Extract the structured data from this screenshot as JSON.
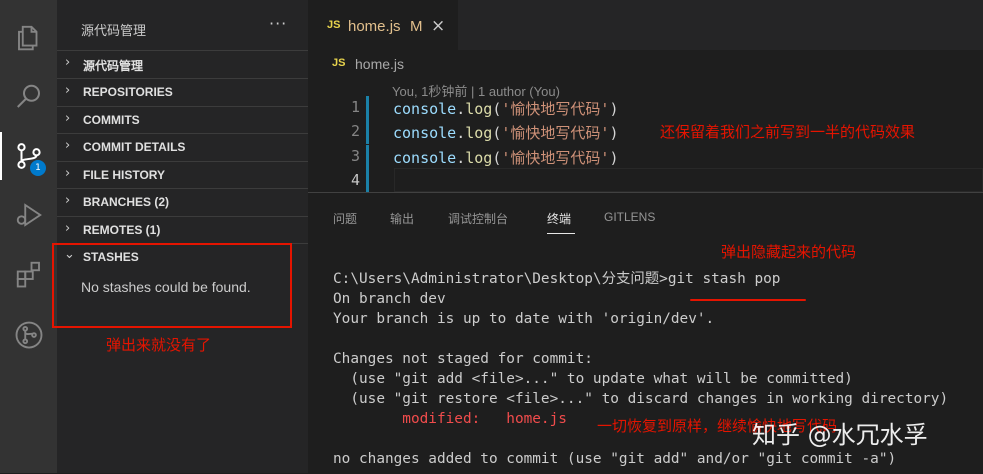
{
  "activity_bar": {
    "source_control_badge": "1"
  },
  "sidebar": {
    "title": "源代码管理",
    "more": "···",
    "sections": [
      {
        "label": "源代码管理",
        "state": "collapsed"
      },
      {
        "label": "REPOSITORIES",
        "state": "collapsed"
      },
      {
        "label": "COMMITS",
        "state": "collapsed"
      },
      {
        "label": "COMMIT DETAILS",
        "state": "collapsed"
      },
      {
        "label": "FILE HISTORY",
        "state": "collapsed"
      },
      {
        "label": "BRANCHES (2)",
        "state": "collapsed"
      },
      {
        "label": "REMOTES (1)",
        "state": "collapsed"
      },
      {
        "label": "STASHES",
        "state": "expanded"
      }
    ],
    "stashes_empty": "No stashes could be found.",
    "annotation": "弹出来就没有了"
  },
  "editor": {
    "tab": {
      "badge": "JS",
      "name": "home.js",
      "modified": "M",
      "close": "×"
    },
    "breadcrumb": {
      "badge": "JS",
      "file": "home.js"
    },
    "blame": "You, 1秒钟前 | 1 author (You)",
    "lines": [
      {
        "n": "1",
        "obj": "console",
        "fn": "log",
        "str": "'愉快地写代码'"
      },
      {
        "n": "2",
        "obj": "console",
        "fn": "log",
        "str": "'愉快地写代码'"
      },
      {
        "n": "3",
        "obj": "console",
        "fn": "log",
        "str": "'愉快地写代码'"
      },
      {
        "n": "4",
        "obj": "",
        "fn": "",
        "str": ""
      }
    ],
    "annotation": "还保留着我们之前写到一半的代码效果"
  },
  "panel": {
    "tabs": [
      "问题",
      "输出",
      "调试控制台",
      "终端",
      "GITLENS"
    ],
    "active_tab": "终端",
    "annotation_top": "弹出隐藏起来的代码",
    "terminal": {
      "prompt": "C:\\Users\\Administrator\\Desktop\\分支问题>",
      "command": "git stash pop",
      "lines": [
        "On branch dev",
        "Your branch is up to date with 'origin/dev'.",
        "",
        "Changes not staged for commit:",
        "  (use \"git add <file>...\" to update what will be committed)",
        "  (use \"git restore <file>...\" to discard changes in working directory)"
      ],
      "modified_label": "        modified:   home.js",
      "after": [
        "",
        "no changes added to commit (use \"git add\" and/or \"git commit -a\")"
      ]
    },
    "annotation_inline": "一切恢复到原样，继续愉快地写代码"
  },
  "watermark": "知乎 @水冗水孚"
}
